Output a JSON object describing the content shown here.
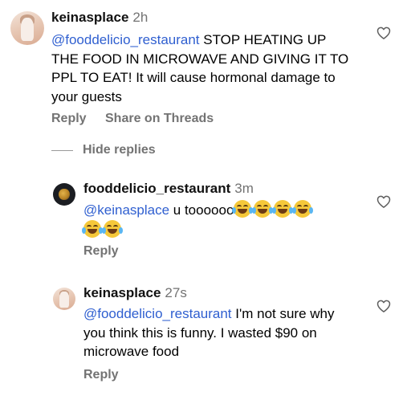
{
  "comments": [
    {
      "username": "keinasplace",
      "time": "2h",
      "mention": "@fooddelicio_restaurant",
      "text": " STOP HEATING UP THE FOOD IN MICROWAVE AND GIVING IT TO PPL TO EAT!  It will cause hormonal damage to your guests",
      "reply_label": "Reply",
      "share_label": "Share on Threads"
    }
  ],
  "hide_replies_label": "Hide replies",
  "replies": [
    {
      "username": "fooddelicio_restaurant",
      "time": "3m",
      "mention": "@keinasplace",
      "text": " u toooooo",
      "emoji_count": 6,
      "emoji_name": "face-with-tears-of-joy",
      "reply_label": "Reply"
    },
    {
      "username": "keinasplace",
      "time": "27s",
      "mention": "@fooddelicio_restaurant",
      "text": " I'm not sure why you think this is funny. I wasted $90 on microwave food",
      "reply_label": "Reply"
    }
  ],
  "icons": {
    "like": "heart-outline-icon"
  },
  "colors": {
    "mention": "#2f5fd0",
    "secondary_text": "#737373"
  }
}
